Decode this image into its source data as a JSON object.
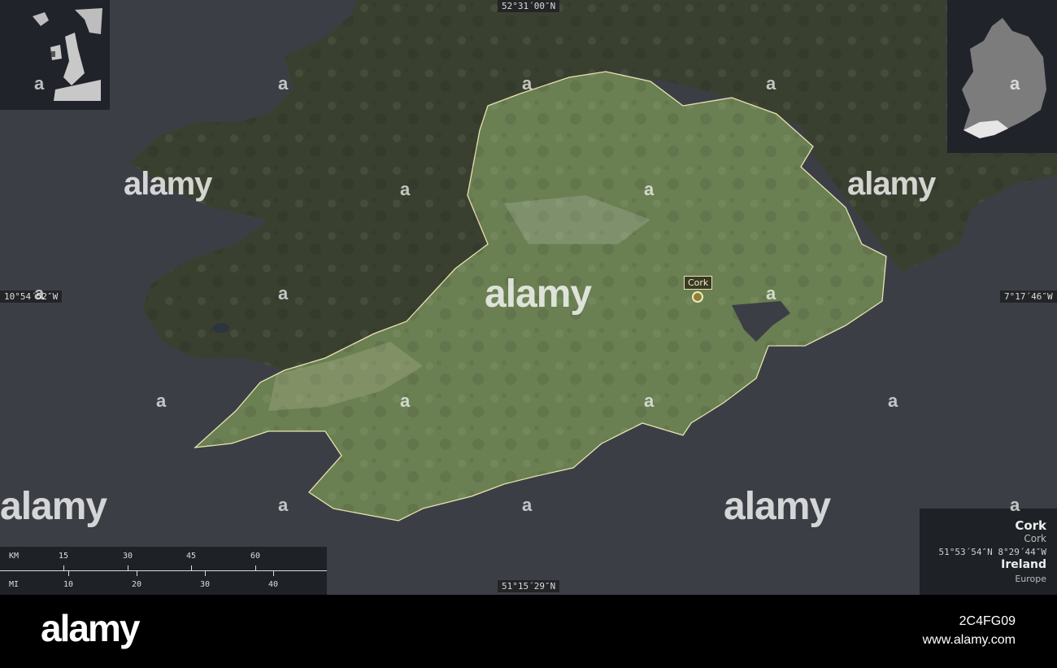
{
  "map": {
    "coords": {
      "top": "52°31´00″N",
      "bottom": "51°15´29″N",
      "left": "10°54´52″W",
      "right": "7°17´46″W"
    },
    "city_label": "Cork",
    "colors": {
      "sea": "#3b3f45",
      "region": "#6a7f52",
      "surrounding_land": "#3a4030",
      "border": "#e8e3b0",
      "inset_background": "#20232a"
    }
  },
  "scale_bar": {
    "km_label": "KM",
    "km_ticks": [
      "15",
      "30",
      "45",
      "60"
    ],
    "mi_label": "MI",
    "mi_ticks": [
      "10",
      "20",
      "30",
      "40"
    ]
  },
  "info": {
    "name": "Cork",
    "subname": "Cork",
    "coordinates": "51°53´54″N 8°29´44″W",
    "country": "Ireland",
    "continent": "Europe"
  },
  "watermark": {
    "text": "alamy",
    "glyph": "a"
  },
  "footer": {
    "logo": "alamy",
    "image_id": "2C4FG09",
    "site": "www.alamy.com"
  }
}
